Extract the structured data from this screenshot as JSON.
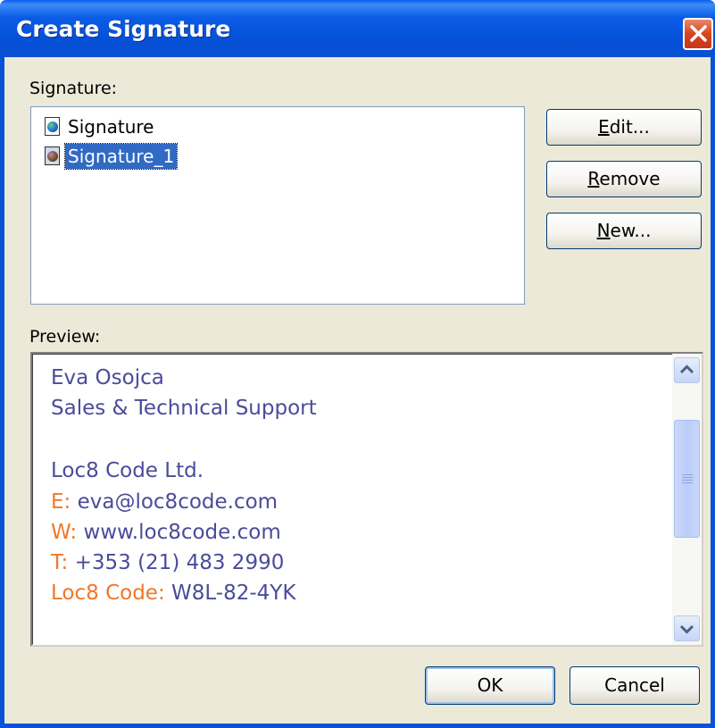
{
  "window": {
    "title": "Create Signature"
  },
  "signature_section": {
    "label": "Signature:",
    "items": [
      {
        "label": "Signature",
        "selected": false
      },
      {
        "label": "Signature_1",
        "selected": true
      }
    ]
  },
  "buttons": {
    "edit": {
      "underline": "E",
      "rest": "dit..."
    },
    "remove": {
      "underline": "R",
      "rest": "emove"
    },
    "new": {
      "underline": "N",
      "rest": "ew..."
    },
    "ok": "OK",
    "cancel": "Cancel"
  },
  "preview": {
    "label": "Preview:",
    "name": "Eva Osojca",
    "role": "Sales & Technical Support",
    "company": "Loc8 Code Ltd.",
    "email_key": "E:",
    "email_value": "eva@loc8code.com",
    "web_key": "W:",
    "web_value": "www.loc8code.com",
    "phone_key": "T:",
    "phone_value": "+353 (21) 483 2990",
    "code_key": "Loc8 Code:",
    "code_value": "W8L-82-4YK"
  },
  "colors": {
    "text_blue": "#4b4b9a",
    "key_orange": "#f07828",
    "selection": "#316ac5",
    "titlebar": "#0a5ce6"
  },
  "icons": [
    "close-icon",
    "signature-doc-icon",
    "scroll-up-icon",
    "scroll-down-icon"
  ]
}
